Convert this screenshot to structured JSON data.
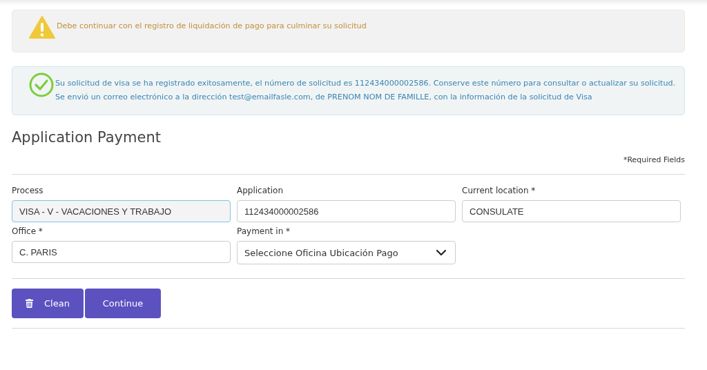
{
  "alerts": [
    {
      "kind": "warning",
      "lines": [
        "Debe continuar con el registro de liquidación de pago para culminar su solicitud"
      ]
    },
    {
      "kind": "success",
      "lines": [
        "Su solicitud de visa se ha registrado exitosamente, el número de solicitud es 112434000002586. Conserve este número para consultar o actualizar su solicitud.",
        "Se envió un correo electrónico a la dirección test@emailfasle.com, de PRENOM NOM DE FAMILLE, con la información de la solicitud de Visa"
      ]
    }
  ],
  "title": "Application Payment",
  "required_note": "*Required Fields",
  "fields": [
    {
      "label": "Process",
      "kind": "input",
      "value": "VISA - V - VACACIONES Y TRABAJO",
      "focused": true
    },
    {
      "label": "Application",
      "kind": "input",
      "value": "112434000002586",
      "focused": false
    },
    {
      "label": "Current location *",
      "kind": "input",
      "value": "CONSULATE",
      "focused": false
    },
    {
      "label": "Office *",
      "kind": "input",
      "value": "C. PARIS",
      "focused": false
    },
    {
      "label": "Payment in *",
      "kind": "select",
      "value": "Seleccione Oficina Ubicación Pago",
      "focused": false
    }
  ],
  "buttons": [
    {
      "label": "Clean",
      "kind": "clean"
    },
    {
      "label": "Continue",
      "kind": "plain"
    }
  ]
}
